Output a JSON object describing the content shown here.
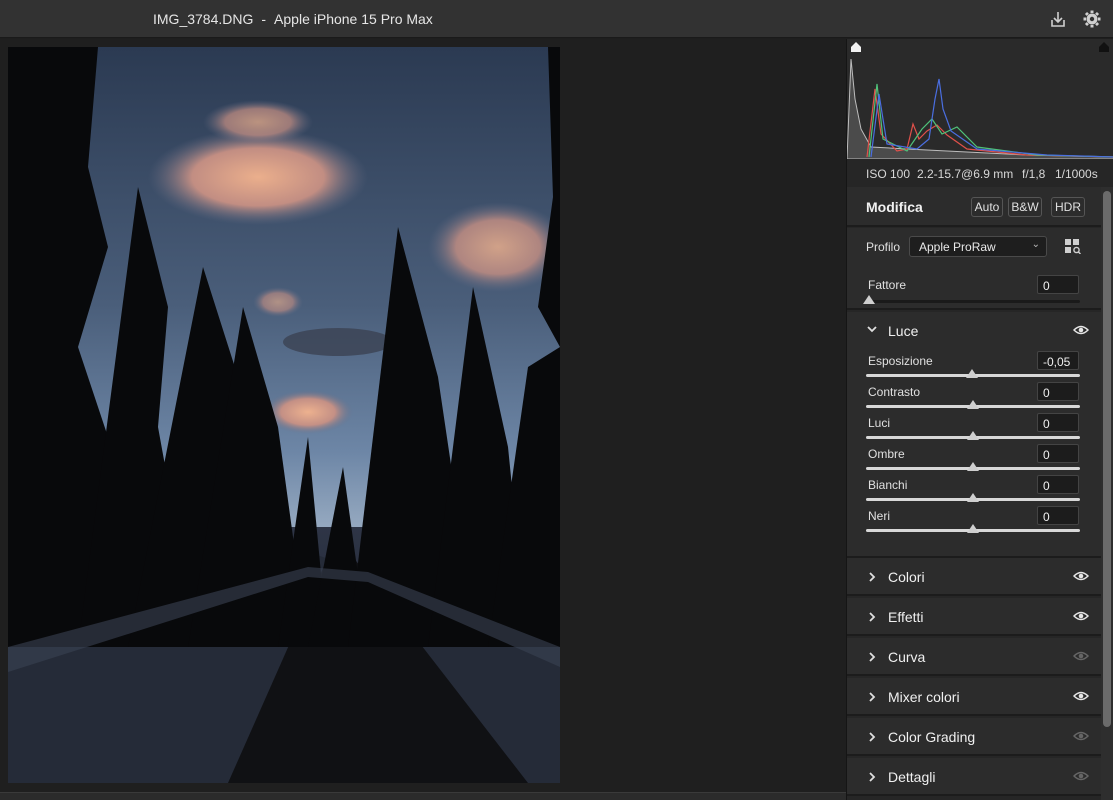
{
  "titlebar": {
    "filename": "IMG_3784.DNG",
    "separator": "-",
    "camera": "Apple iPhone 15 Pro Max"
  },
  "histogram": {
    "exif": {
      "iso": "ISO 100",
      "focal": "2.2-15.7@6.9 mm",
      "aperture": "f/1,8",
      "shutter": "1/1000s"
    },
    "colors": {
      "red": "#e0504a",
      "green": "#4fc27a",
      "blue": "#4a6ee0",
      "gray": "#9a9a9a"
    }
  },
  "modifica": {
    "title": "Modifica",
    "buttons": [
      "Auto",
      "B&W",
      "HDR"
    ]
  },
  "profile": {
    "label": "Profilo",
    "value": "Apple ProRaw",
    "amount_label": "Fattore",
    "amount_value": "0"
  },
  "luce": {
    "title": "Luce",
    "sliders": [
      {
        "label": "Esposizione",
        "value": "-0,05"
      },
      {
        "label": "Contrasto",
        "value": "0"
      },
      {
        "label": "Luci",
        "value": "0"
      },
      {
        "label": "Ombre",
        "value": "0"
      },
      {
        "label": "Bianchi",
        "value": "0"
      },
      {
        "label": "Neri",
        "value": "0"
      }
    ]
  },
  "sections": [
    {
      "title": "Colori",
      "visible": true
    },
    {
      "title": "Effetti",
      "visible": true
    },
    {
      "title": "Curva",
      "visible": false
    },
    {
      "title": "Mixer colori",
      "visible": true
    },
    {
      "title": "Color Grading",
      "visible": false
    },
    {
      "title": "Dettagli",
      "visible": false
    }
  ],
  "icons": {
    "export": "export-icon",
    "settings": "gear-icon",
    "eye": "eye-icon",
    "chevron": "chevron-icon",
    "profile_browser": "profile-browser-icon"
  }
}
